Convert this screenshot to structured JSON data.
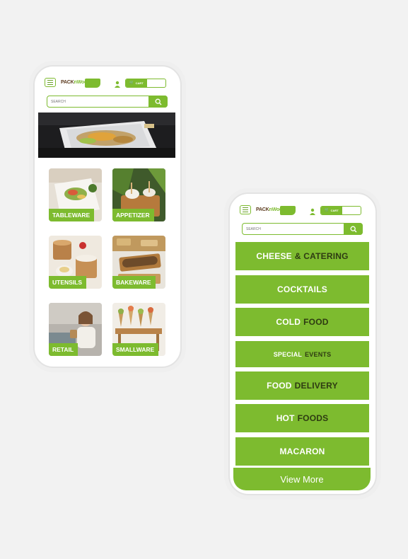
{
  "colors": {
    "accent": "#7dbb2f",
    "dark_word": "#2e3b12",
    "background": "#f2f2f2",
    "phone_body": "#ffffff"
  },
  "header": {
    "logo_text_left": "PACK",
    "logo_text_mid": "n",
    "logo_text_right": "Wood",
    "cart_label": "CART",
    "search_placeholder": "SEARCH",
    "icons": [
      "hamburger-menu-icon",
      "user-icon",
      "cart-icon",
      "search-icon"
    ]
  },
  "phone1": {
    "tiles": [
      {
        "label": "TABLEWARE"
      },
      {
        "label": "APPETIZER"
      },
      {
        "label": "UTENSILS"
      },
      {
        "label": "BAKEWARE"
      },
      {
        "label": "RETAIL"
      },
      {
        "label": "SMALLWARE"
      }
    ]
  },
  "phone2": {
    "categories": [
      {
        "w1": "CHEESE",
        "w2": "& CATERING"
      },
      {
        "w1": "COCKTAILS",
        "w2": ""
      },
      {
        "w1": "COLD",
        "w2": "FOOD"
      },
      {
        "w1": "SPECIAL",
        "w2": "EVENTS"
      },
      {
        "w1": "FOOD",
        "w2": "DELIVERY"
      },
      {
        "w1": "HOT",
        "w2": "FOODS"
      },
      {
        "w1": "MACARON",
        "w2": ""
      }
    ],
    "view_more": "View More"
  }
}
